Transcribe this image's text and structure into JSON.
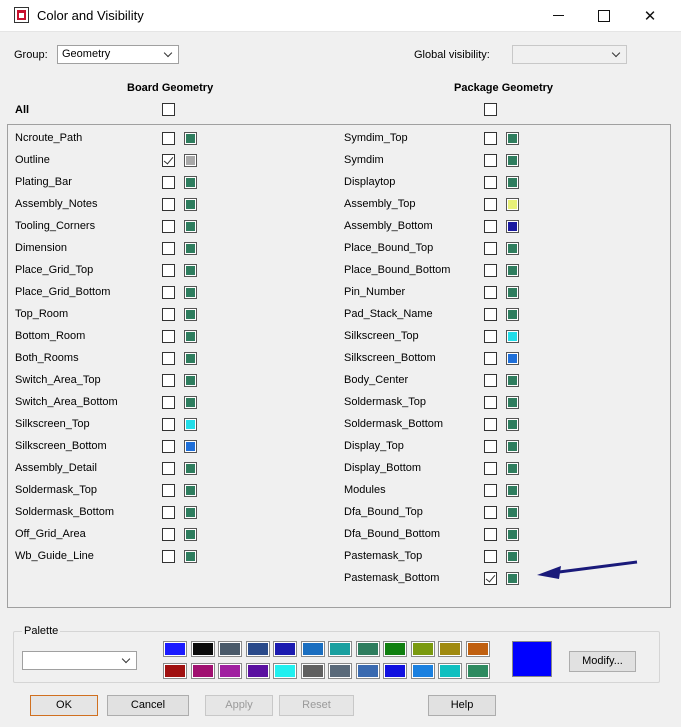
{
  "window": {
    "title": "Color and Visibility",
    "icon": "app-icon",
    "buttons": [
      "minimize-icon",
      "maximize-icon",
      "close-icon"
    ]
  },
  "group": {
    "label": "Group:",
    "value": "Geometry"
  },
  "global_visibility": {
    "label": "Global visibility:",
    "value": ""
  },
  "all_label": "All",
  "board": {
    "heading": "Board Geometry",
    "all_checked": false,
    "rows": [
      {
        "name": "Ncroute_Path",
        "checked": false,
        "color": "#2e7d5e"
      },
      {
        "name": "Outline",
        "checked": true,
        "color": "#a8a8a8"
      },
      {
        "name": "Plating_Bar",
        "checked": false,
        "color": "#2e7d5e"
      },
      {
        "name": "Assembly_Notes",
        "checked": false,
        "color": "#2e7d5e"
      },
      {
        "name": "Tooling_Corners",
        "checked": false,
        "color": "#2e7d5e"
      },
      {
        "name": "Dimension",
        "checked": false,
        "color": "#2e7d5e"
      },
      {
        "name": "Place_Grid_Top",
        "checked": false,
        "color": "#2e7d5e"
      },
      {
        "name": "Place_Grid_Bottom",
        "checked": false,
        "color": "#2e7d5e"
      },
      {
        "name": "Top_Room",
        "checked": false,
        "color": "#2e7d5e"
      },
      {
        "name": "Bottom_Room",
        "checked": false,
        "color": "#2e7d5e"
      },
      {
        "name": "Both_Rooms",
        "checked": false,
        "color": "#2e7d5e"
      },
      {
        "name": "Switch_Area_Top",
        "checked": false,
        "color": "#2e7d5e"
      },
      {
        "name": "Switch_Area_Bottom",
        "checked": false,
        "color": "#2e7d5e"
      },
      {
        "name": "Silkscreen_Top",
        "checked": false,
        "color": "#22dde8"
      },
      {
        "name": "Silkscreen_Bottom",
        "checked": false,
        "color": "#1e6fd9"
      },
      {
        "name": "Assembly_Detail",
        "checked": false,
        "color": "#2e7d5e"
      },
      {
        "name": "Soldermask_Top",
        "checked": false,
        "color": "#2e7d5e"
      },
      {
        "name": "Soldermask_Bottom",
        "checked": false,
        "color": "#2e7d5e"
      },
      {
        "name": "Off_Grid_Area",
        "checked": false,
        "color": "#2e7d5e"
      },
      {
        "name": "Wb_Guide_Line",
        "checked": false,
        "color": "#2e7d5e"
      }
    ]
  },
  "package": {
    "heading": "Package Geometry",
    "all_checked": false,
    "rows": [
      {
        "name": "Symdim_Top",
        "checked": false,
        "color": "#2e7d5e"
      },
      {
        "name": "Symdim",
        "checked": false,
        "color": "#2e7d5e"
      },
      {
        "name": "Displaytop",
        "checked": false,
        "color": "#2e7d5e"
      },
      {
        "name": "Assembly_Top",
        "checked": false,
        "color": "#e8f078"
      },
      {
        "name": "Assembly_Bottom",
        "checked": false,
        "color": "#1a1aa0"
      },
      {
        "name": "Place_Bound_Top",
        "checked": false,
        "color": "#2e7d5e"
      },
      {
        "name": "Place_Bound_Bottom",
        "checked": false,
        "color": "#2e7d5e"
      },
      {
        "name": "Pin_Number",
        "checked": false,
        "color": "#2e7d5e"
      },
      {
        "name": "Pad_Stack_Name",
        "checked": false,
        "color": "#2e7d5e"
      },
      {
        "name": "Silkscreen_Top",
        "checked": false,
        "color": "#22dde8"
      },
      {
        "name": "Silkscreen_Bottom",
        "checked": false,
        "color": "#1e6fd9"
      },
      {
        "name": "Body_Center",
        "checked": false,
        "color": "#2e7d5e"
      },
      {
        "name": "Soldermask_Top",
        "checked": false,
        "color": "#2e7d5e"
      },
      {
        "name": "Soldermask_Bottom",
        "checked": false,
        "color": "#2e7d5e"
      },
      {
        "name": "Display_Top",
        "checked": false,
        "color": "#2e7d5e"
      },
      {
        "name": "Display_Bottom",
        "checked": false,
        "color": "#2e7d5e"
      },
      {
        "name": "Modules",
        "checked": false,
        "color": "#2e7d5e"
      },
      {
        "name": "Dfa_Bound_Top",
        "checked": false,
        "color": "#2e7d5e"
      },
      {
        "name": "Dfa_Bound_Bottom",
        "checked": false,
        "color": "#2e7d5e"
      },
      {
        "name": "Pastemask_Top",
        "checked": false,
        "color": "#2e7d5e"
      },
      {
        "name": "Pastemask_Bottom",
        "checked": true,
        "color": "#2e7d5e"
      }
    ]
  },
  "palette": {
    "label": "Palette",
    "value": "",
    "colors": [
      "#1a1aff",
      "#0a0a0a",
      "#4a5a6a",
      "#2a4a8a",
      "#1a1ab0",
      "#1a6ec0",
      "#1aa0a0",
      "#2e7d5e",
      "#108010",
      "#7a9a10",
      "#a08a10",
      "#c06010",
      "#a01010",
      "#a01070",
      "#a020a0",
      "#5a10a0",
      "#20f0f0",
      "#606060",
      "#5a6a7a",
      "#3a6ab0",
      "#1010e0",
      "#1a80e0",
      "#10c0c0",
      "#2e8a60"
    ],
    "selected": "#0000ff"
  },
  "buttons": {
    "modify": "Modify...",
    "ok": "OK",
    "cancel": "Cancel",
    "apply": "Apply",
    "reset": "Reset",
    "help": "Help"
  }
}
